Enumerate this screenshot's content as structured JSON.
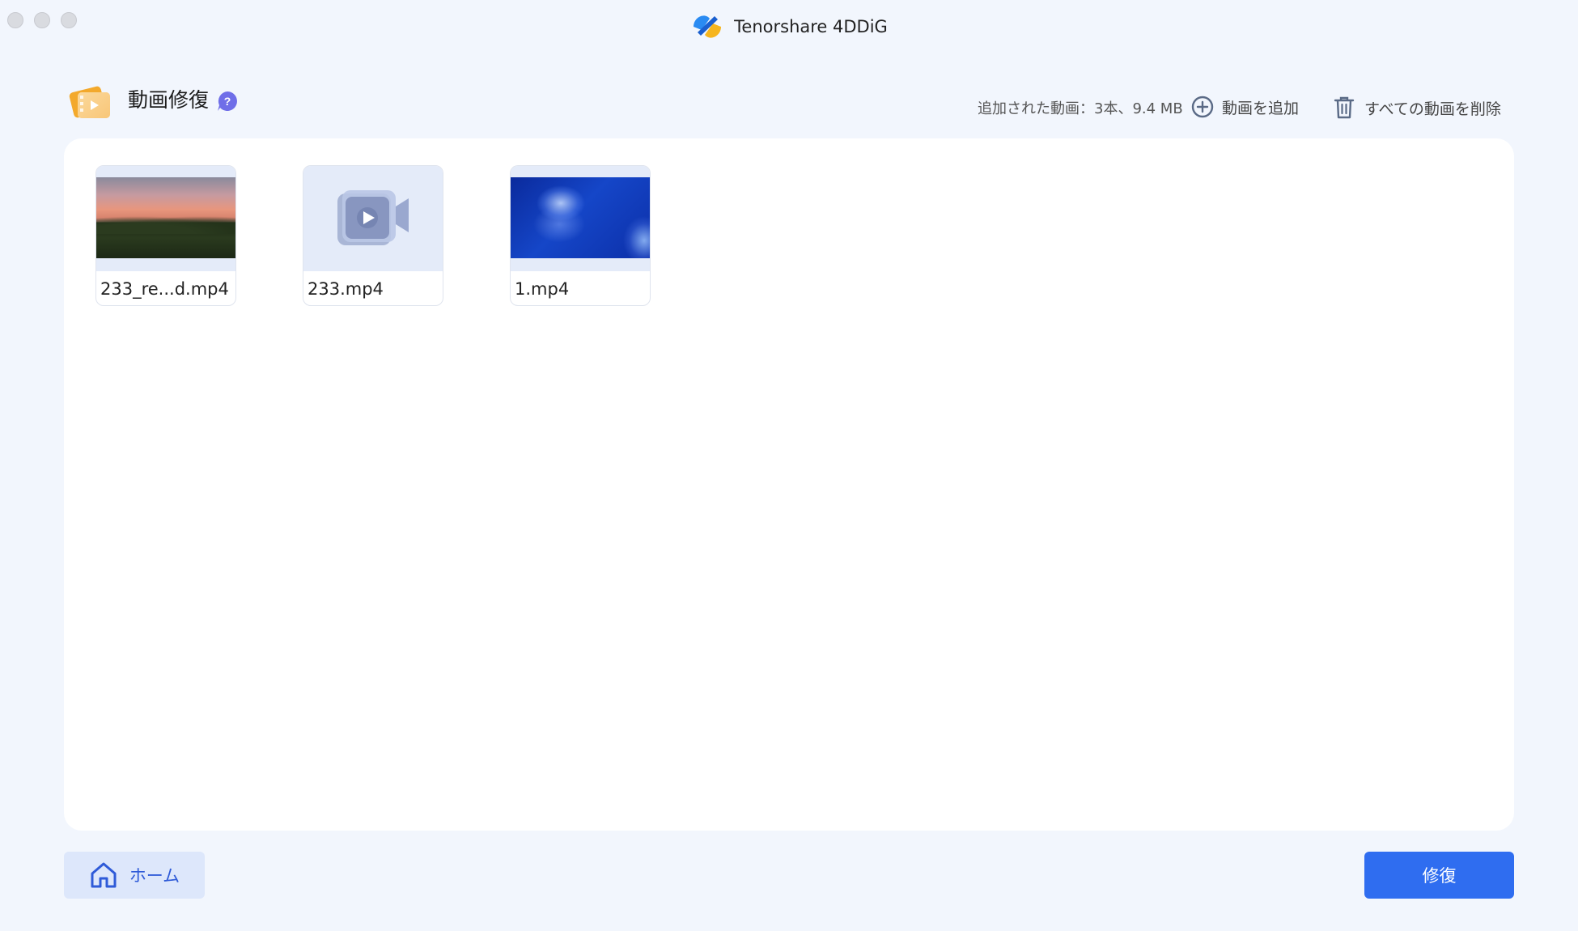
{
  "window": {
    "title": "Tenorshare 4DDiG",
    "logo_icon": "tenorshare-logo-icon"
  },
  "header": {
    "title": "動画修復",
    "feature_icon": "video-repair-icon",
    "help_icon": "question-icon",
    "added_info": "追加された動画：3本、9.4 MB",
    "add_label": "動画を追加",
    "delete_all_label": "すべての動画を削除"
  },
  "files": [
    {
      "name": "233_re...d.mp4",
      "thumbnail": "sunset-over-forest"
    },
    {
      "name": "233.mp4",
      "thumbnail": "video-placeholder-icon"
    },
    {
      "name": "1.mp4",
      "thumbnail": "jellyfish"
    }
  ],
  "footer": {
    "home_label": "ホーム",
    "repair_label": "修復"
  },
  "colors": {
    "accent": "#2f6df0",
    "home_button_bg": "#dde7fb",
    "window_bg": "#f2f6fd",
    "help_badge": "#6f6ee8"
  }
}
